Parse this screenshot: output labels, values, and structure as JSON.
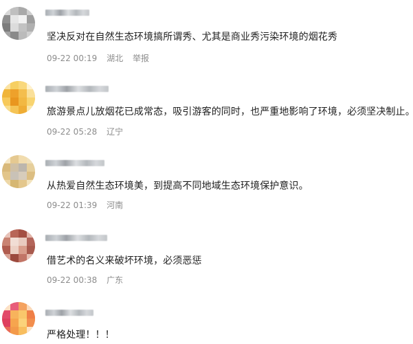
{
  "comments": [
    {
      "text": "坚决反对在自然生态环境搞所谓秀、尤其是商业秀污染环境的烟花秀",
      "time": "09-22 00:19",
      "location": "湖北",
      "report": "举报"
    },
    {
      "text": "旅游景点儿放烟花已成常态，吸引游客的同时，也严重地影响了环境，必须坚决制止。",
      "time": "09-22 05:28",
      "location": "辽宁"
    },
    {
      "text": "从热爱自然生态环境美，到提高不同地域生态环境保护意识。",
      "time": "09-22 01:39",
      "location": "河南"
    },
    {
      "text": "借艺术的名义来破坏环境，必须恶惩",
      "time": "09-22 00:38",
      "location": "广东"
    },
    {
      "text": "严格处理！！！"
    }
  ]
}
